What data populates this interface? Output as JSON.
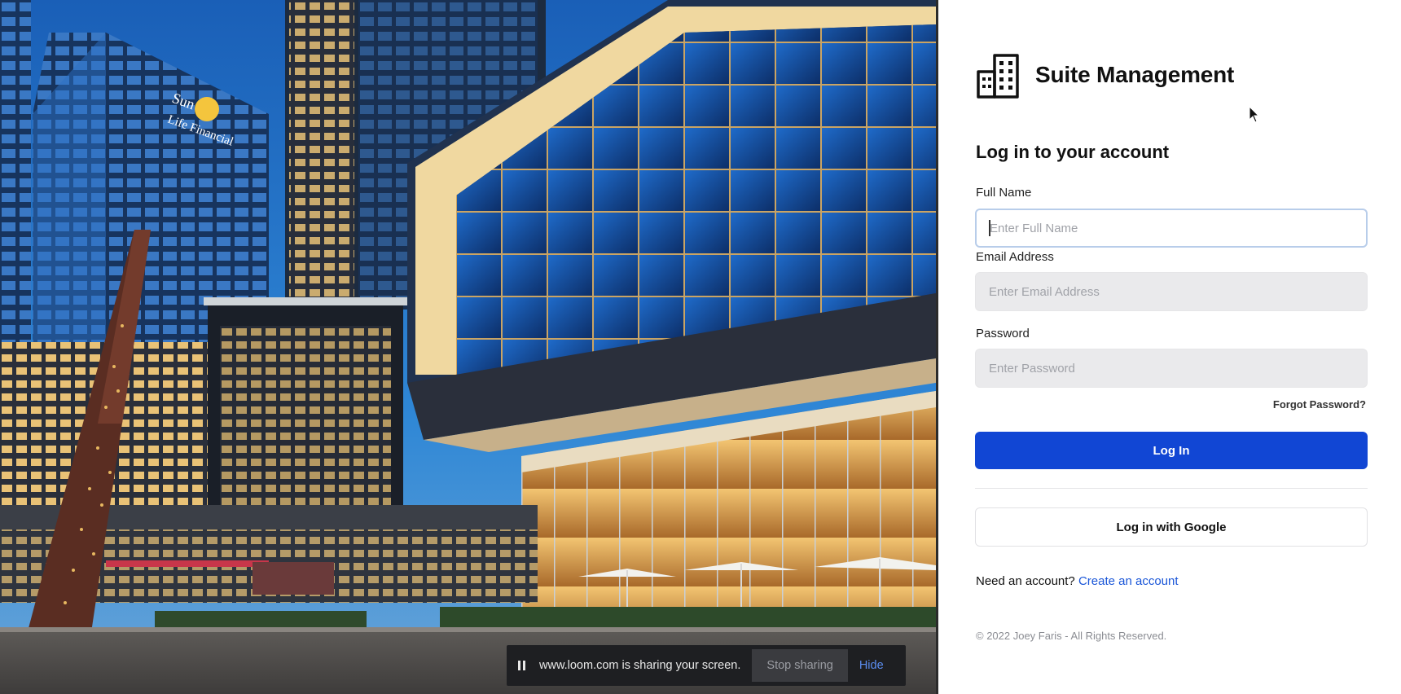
{
  "brand": {
    "name": "Suite Management",
    "icon": "building-icon"
  },
  "login": {
    "heading": "Log in to your account",
    "full_name": {
      "label": "Full Name",
      "placeholder": "Enter Full Name",
      "value": ""
    },
    "email": {
      "label": "Email Address",
      "placeholder": "Enter Email Address",
      "value": ""
    },
    "password": {
      "label": "Password",
      "placeholder": "Enter Password",
      "value": ""
    },
    "forgot_password": "Forgot Password?",
    "login_button": "Log In",
    "google_button": "Log in with Google",
    "signup_prompt": "Need an account?",
    "signup_link": "Create an account",
    "copyright": "© 2022 Joey Faris - All Rights Reserved."
  },
  "photo": {
    "description_icon": "city-building-photo",
    "sign_text": "Sun Life Financial"
  },
  "screen_share": {
    "icon": "pause-icon",
    "message": "www.loom.com is sharing your screen.",
    "stop_label": "Stop sharing",
    "hide_label": "Hide"
  },
  "colors": {
    "primary": "#1146d4",
    "link": "#1a56d8",
    "input_bg": "#eaeaec",
    "focus_border": "#b8cdea"
  }
}
